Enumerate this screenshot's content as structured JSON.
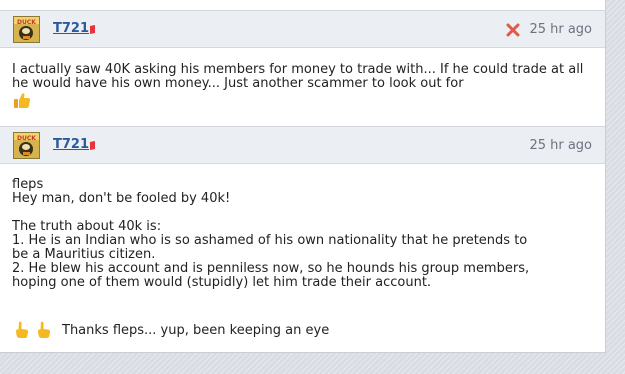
{
  "posts": [
    {
      "username": "T721",
      "time": "25 hr ago",
      "body": "I actually saw 40K asking his members for money to trade with... If he could trade at all he would have his own money... Just another scammer to look out for",
      "reaction_icon": "thumbs-up-icon"
    },
    {
      "username": "T721",
      "time": "25 hr ago",
      "lines": [
        "fleps",
        "Hey man, don't be fooled by 40k!",
        "",
        "The truth about 40k is:",
        "1. He is an Indian who is so ashamed of his own nationality that he pretends to",
        "be a Mauritius citizen.",
        "2. He blew his account and is penniless now, so he hounds his group members,",
        "hoping one of them would (stupidly) let him trade their account."
      ],
      "reaction_text": "Thanks fleps... yup, been keeping an eye",
      "reaction_icon": "pointing-hand-icon"
    }
  ],
  "colors": {
    "username": "#2a5a9c",
    "header_bg": "#ebeef2",
    "time": "#6b7480",
    "delete": "#e05a4a",
    "flag": "#e8323c"
  }
}
